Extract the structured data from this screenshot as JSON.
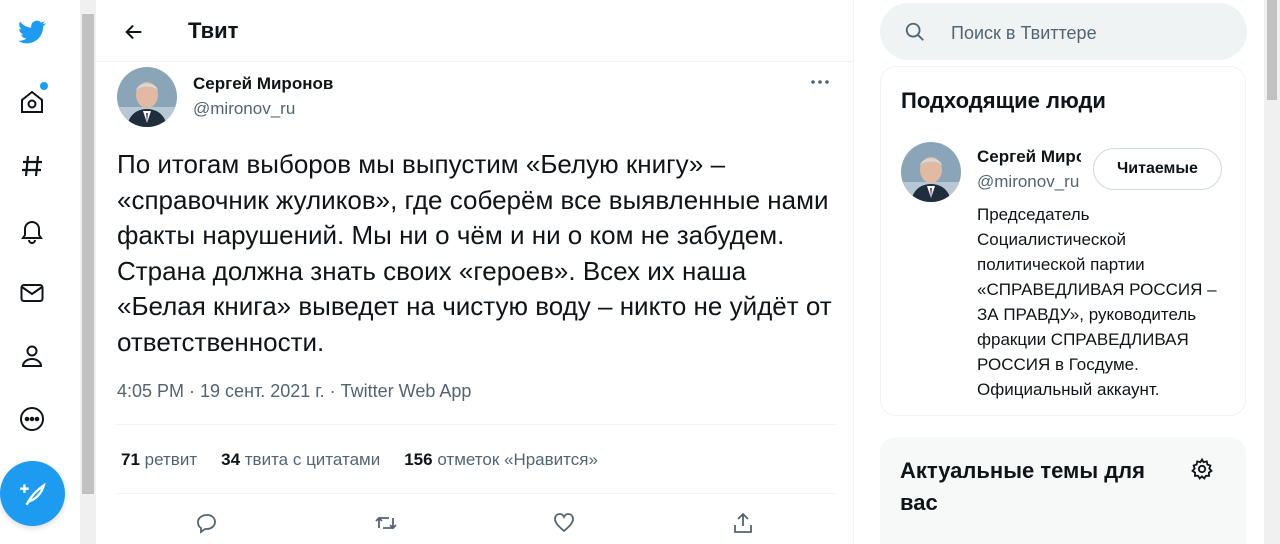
{
  "colors": {
    "accent": "#1d9bf0",
    "text": "#0f1419",
    "muted": "#536471",
    "border": "#eff3f4"
  },
  "nav": {
    "logo_icon": "twitter-bird-icon",
    "items": [
      {
        "name": "home-icon"
      },
      {
        "name": "explore-hashtag-icon"
      },
      {
        "name": "notifications-bell-icon"
      },
      {
        "name": "messages-envelope-icon"
      },
      {
        "name": "profile-person-icon"
      },
      {
        "name": "more-circle-icon"
      }
    ],
    "compose_icon": "compose-feather-icon"
  },
  "header": {
    "title": "Твит",
    "back_icon": "arrow-left-icon"
  },
  "tweet": {
    "author_name": "Сергей Миронов",
    "author_handle": "@mironov_ru",
    "text": "По итогам выборов мы выпустим «Белую книгу» – «справочник жуликов», где соберём все выявленные нами факты нарушений. Мы ни о чём и ни о ком не забудем. Страна должна знать своих «героев». Всех их наша «Белая книга» выведет на чистую воду – никто не уйдёт от ответственности.",
    "meta": "4:05 PM · 19 сент. 2021 г. · Twitter Web App",
    "stats": {
      "retweets_count": "71",
      "retweets_label": "ретвит",
      "quotes_count": "34",
      "quotes_label": "твита с цитатами",
      "likes_count": "156",
      "likes_label": "отметок «Нравится»"
    }
  },
  "search": {
    "placeholder": "Поиск в Твиттере"
  },
  "who_to_follow": {
    "title": "Подходящие люди",
    "person": {
      "name": "Сергей Миронов",
      "handle": "@mironov_ru",
      "button": "Читаемые",
      "bio": "Председатель Социалистической политической партии «СПРАВЕДЛИВАЯ РОССИЯ – ЗА ПРАВДУ», руководитель фракции СПРАВЕДЛИВАЯ РОССИЯ в Госдуме. Официальный аккаунт."
    }
  },
  "trends": {
    "title": "Актуальные темы для вас"
  }
}
